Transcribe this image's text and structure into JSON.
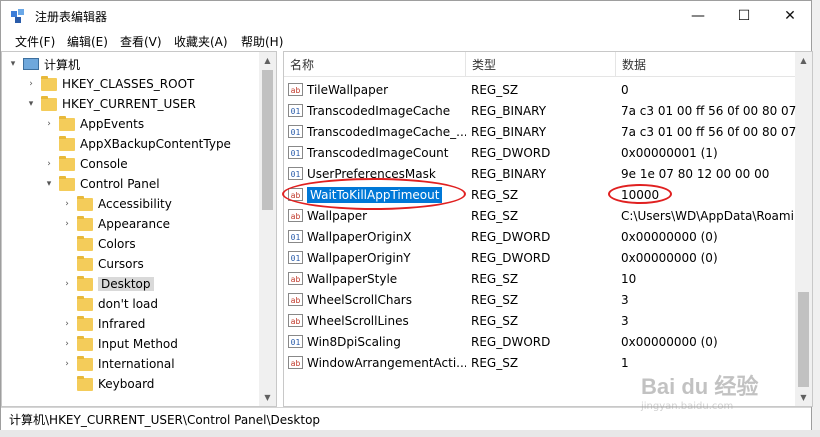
{
  "window": {
    "title": "注册表编辑器",
    "controls": {
      "minimize": "—",
      "maximize": "☐",
      "close": "✕"
    }
  },
  "menu": [
    "文件(F)",
    "编辑(E)",
    "查看(V)",
    "收藏夹(A)",
    "帮助(H)"
  ],
  "tree": [
    {
      "label": "计算机",
      "expander": "▾",
      "icon": "computer-icon"
    },
    {
      "label": "HKEY_CLASSES_ROOT",
      "expander": "›",
      "icon": "folder-icon"
    },
    {
      "label": "HKEY_CURRENT_USER",
      "expander": "▾",
      "icon": "folder-icon"
    },
    {
      "label": "AppEvents",
      "expander": "›",
      "icon": "folder-icon"
    },
    {
      "label": "AppXBackupContentType",
      "expander": "",
      "icon": "folder-icon"
    },
    {
      "label": "Console",
      "expander": "›",
      "icon": "folder-icon"
    },
    {
      "label": "Control Panel",
      "expander": "▾",
      "icon": "folder-icon"
    },
    {
      "label": "Accessibility",
      "expander": "›",
      "icon": "folder-icon"
    },
    {
      "label": "Appearance",
      "expander": "›",
      "icon": "folder-icon"
    },
    {
      "label": "Colors",
      "expander": "",
      "icon": "folder-icon"
    },
    {
      "label": "Cursors",
      "expander": "",
      "icon": "folder-icon"
    },
    {
      "label": "Desktop",
      "expander": "›",
      "icon": "folder-icon",
      "selected": true
    },
    {
      "label": "don't load",
      "expander": "",
      "icon": "folder-icon"
    },
    {
      "label": "Infrared",
      "expander": "›",
      "icon": "folder-icon"
    },
    {
      "label": "Input Method",
      "expander": "›",
      "icon": "folder-icon"
    },
    {
      "label": "International",
      "expander": "›",
      "icon": "folder-icon"
    },
    {
      "label": "Keyboard",
      "expander": "",
      "icon": "folder-icon"
    }
  ],
  "columns": {
    "name": "名称",
    "type": "类型",
    "data": "数据"
  },
  "values": [
    {
      "name": "TileWallpaper",
      "type": "REG_SZ",
      "data": "0",
      "kind": "sz"
    },
    {
      "name": "TranscodedImageCache",
      "type": "REG_BINARY",
      "data": "7a c3 01 00 ff 56 0f 00 80 07 0",
      "kind": "bin"
    },
    {
      "name": "TranscodedImageCache_...",
      "type": "REG_BINARY",
      "data": "7a c3 01 00 ff 56 0f 00 80 07 0",
      "kind": "bin"
    },
    {
      "name": "TranscodedImageCount",
      "type": "REG_DWORD",
      "data": "0x00000001 (1)",
      "kind": "bin"
    },
    {
      "name": "UserPreferencesMask",
      "type": "REG_BINARY",
      "data": "9e 1e 07 80 12 00 00 00",
      "kind": "bin"
    },
    {
      "name": "WaitToKillAppTimeout",
      "type": "REG_SZ",
      "data": "10000",
      "kind": "sz",
      "selected": true
    },
    {
      "name": "Wallpaper",
      "type": "REG_SZ",
      "data": "C:\\Users\\WD\\AppData\\Roami",
      "kind": "sz"
    },
    {
      "name": "WallpaperOriginX",
      "type": "REG_DWORD",
      "data": "0x00000000 (0)",
      "kind": "bin"
    },
    {
      "name": "WallpaperOriginY",
      "type": "REG_DWORD",
      "data": "0x00000000 (0)",
      "kind": "bin"
    },
    {
      "name": "WallpaperStyle",
      "type": "REG_SZ",
      "data": "10",
      "kind": "sz"
    },
    {
      "name": "WheelScrollChars",
      "type": "REG_SZ",
      "data": "3",
      "kind": "sz"
    },
    {
      "name": "WheelScrollLines",
      "type": "REG_SZ",
      "data": "3",
      "kind": "sz"
    },
    {
      "name": "Win8DpiScaling",
      "type": "REG_DWORD",
      "data": "0x00000000 (0)",
      "kind": "bin"
    },
    {
      "name": "WindowArrangementActi...",
      "type": "REG_SZ",
      "data": "1",
      "kind": "sz"
    }
  ],
  "icon_text": {
    "sz": "ab",
    "bin": "01"
  },
  "status": {
    "path": "计算机\\HKEY_CURRENT_USER\\Control Panel\\Desktop"
  },
  "watermark": {
    "text": "Bai du 经验",
    "sub": "jingyan.baidu.com"
  },
  "colors": {
    "selection": "#0078d7",
    "annotation": "#e02020"
  }
}
